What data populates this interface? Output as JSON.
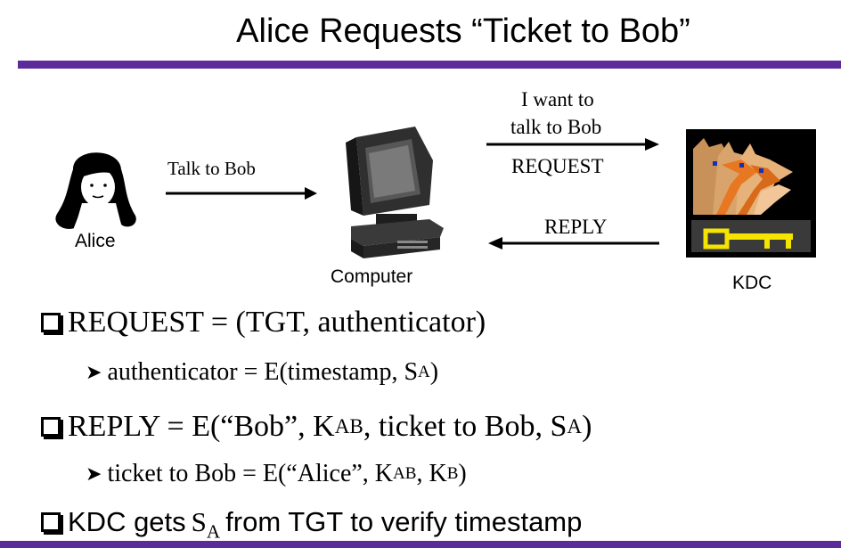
{
  "title": "Alice Requests “Ticket to Bob”",
  "colors": {
    "accent": "#5b2b9a",
    "kdc_bg": "#000000",
    "key": "#f5e400"
  },
  "diagram": {
    "alice_label": "Alice",
    "computer_label": "Computer",
    "kdc_label": "KDC",
    "talk_label": "Talk to Bob",
    "want_line1": "I want to",
    "want_line2": "talk to Bob",
    "request_label": "REQUEST",
    "reply_label": "REPLY"
  },
  "bullets": {
    "b1_text": "REQUEST = (TGT, authenticator)",
    "b1_sub_pre": "authenticator = E(timestamp, S",
    "b1_sub_s": "A",
    "b1_sub_post": ")",
    "b2_pre": "REPLY = E(“Bob”, K",
    "b2_k": "AB",
    "b2_mid": ", ticket to Bob, S",
    "b2_s": "A",
    "b2_post": ")",
    "b2_sub_pre": "ticket to Bob = E(“Alice”, K",
    "b2_sub_k1": "AB",
    "b2_sub_mid": ", K",
    "b2_sub_k2": "B",
    "b2_sub_post": ")",
    "b3_pre": "KDC gets",
    "b3_s": "S",
    "b3_s_sub": "A",
    "b3_post": "from TGT to verify timestamp"
  }
}
